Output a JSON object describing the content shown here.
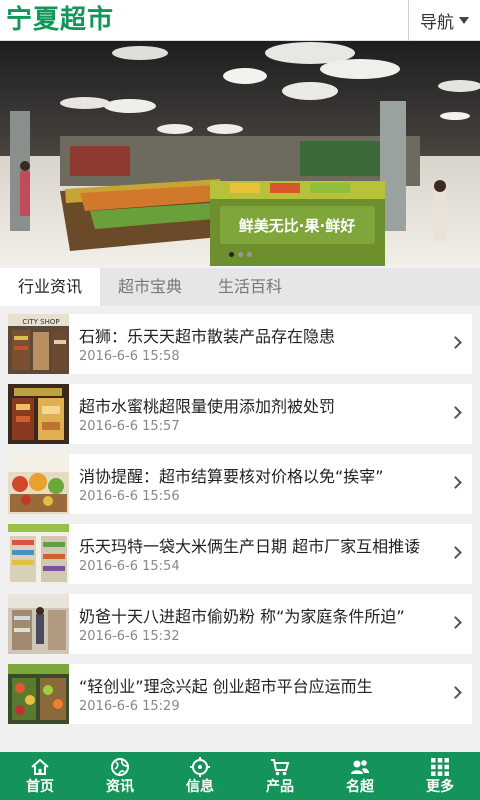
{
  "header": {
    "logo": "宁夏超市",
    "nav_label": "导航"
  },
  "banner": {
    "sign_text": "鲜美无比·果·鲜好",
    "slide_count": 3,
    "active_slide": 1
  },
  "tabs": [
    {
      "label": "行业资讯",
      "active": true
    },
    {
      "label": "超市宝典",
      "active": false
    },
    {
      "label": "生活百科",
      "active": false
    }
  ],
  "news": [
    {
      "title": "石狮：乐天天超市散装产品存在隐患",
      "date": "2016-6-6 15:58",
      "thumb_sign": "CITY SHOP"
    },
    {
      "title": "超市水蜜桃超限量使用添加剂被处罚",
      "date": "2016-6-6 15:57"
    },
    {
      "title": "消协提醒：超市结算要核对价格以免“挨宰”",
      "date": "2016-6-6 15:56"
    },
    {
      "title": "乐天玛特一袋大米俩生产日期 超市厂家互相推诿",
      "date": "2016-6-6 15:54"
    },
    {
      "title": "奶爸十天八进超市偷奶粉 称“为家庭条件所迫”",
      "date": "2016-6-6 15:32"
    },
    {
      "title": "“轻创业”理念兴起 创业超市平台应运而生",
      "date": "2016-6-6 15:29"
    }
  ],
  "footer": [
    {
      "label": "首页",
      "icon": "home-icon"
    },
    {
      "label": "资讯",
      "icon": "globe-icon"
    },
    {
      "label": "信息",
      "icon": "target-icon"
    },
    {
      "label": "产品",
      "icon": "cart-icon"
    },
    {
      "label": "名超",
      "icon": "users-icon"
    },
    {
      "label": "更多",
      "icon": "grid-icon"
    }
  ],
  "colors": {
    "brand": "#12965a",
    "footer_bg": "#14935b"
  }
}
